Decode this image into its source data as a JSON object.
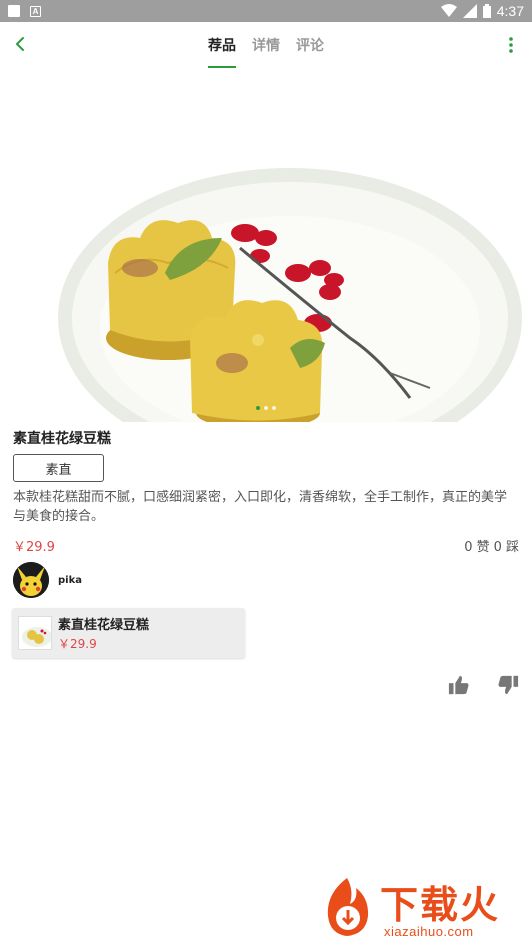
{
  "status_bar": {
    "time": "4:37"
  },
  "nav": {
    "tabs": [
      {
        "label": "荐品",
        "active": true
      },
      {
        "label": "详情",
        "active": false
      },
      {
        "label": "评论",
        "active": false
      }
    ]
  },
  "hero": {
    "image_alt": "素直桂花绿豆糕",
    "page_count": 3,
    "current_page": 1
  },
  "product": {
    "title": "素直桂花绿豆糕",
    "tag_label": "素直",
    "description": "本款桂花糕甜而不腻，口感细润紧密，入口即化，清香绵软，全手工制作，真正的美学与美食的接合。",
    "price": "￥29.9",
    "likes_text": "0 赞",
    "dislikes_text": "0 踩"
  },
  "author": {
    "name": "pika"
  },
  "linked_item": {
    "title": "素直桂花绿豆糕",
    "price": "￥29.9"
  },
  "watermark": {
    "brand": "下载火",
    "url": "xiazaihuo.com"
  },
  "colors": {
    "accent": "#2e9a3e",
    "price": "#e04545",
    "statusbar": "#9e9e9e",
    "watermark": "#e84d1a"
  }
}
